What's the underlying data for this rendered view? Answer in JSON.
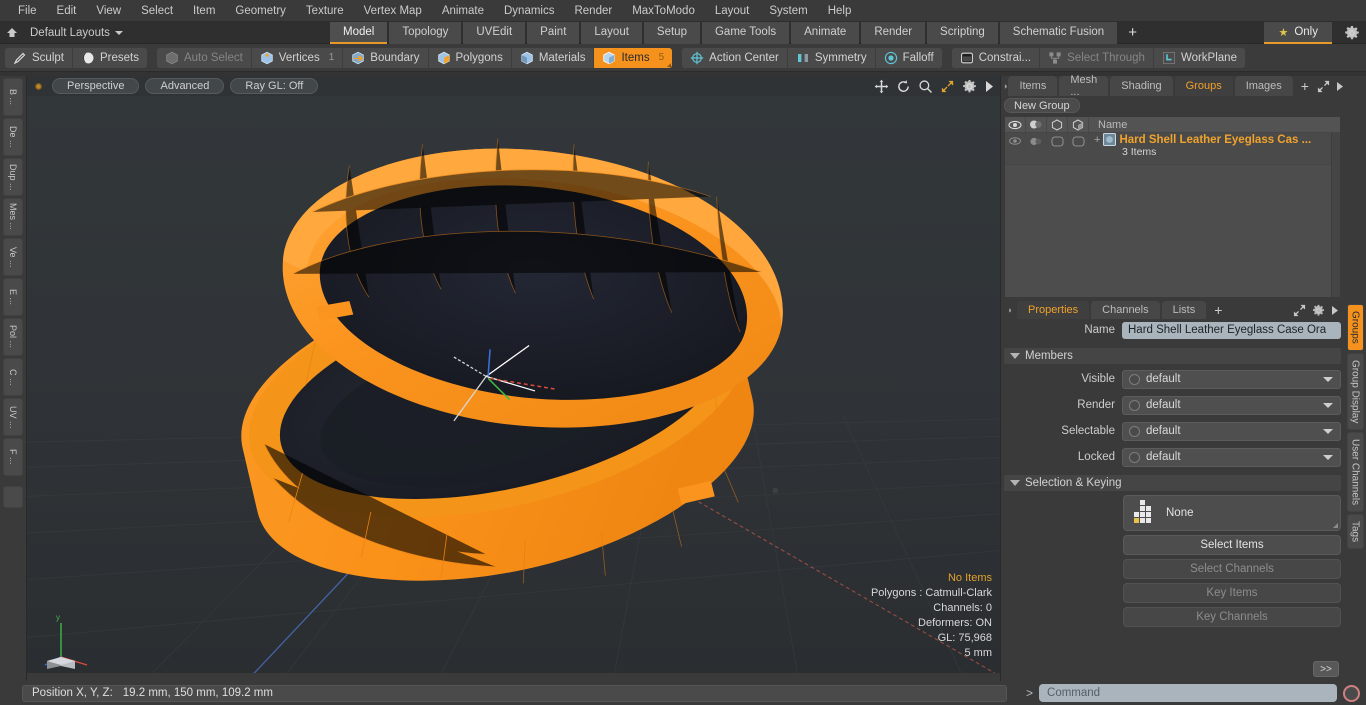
{
  "app": {
    "title": "MODO 3D Modeling"
  },
  "menubar": {
    "items": [
      "File",
      "Edit",
      "View",
      "Select",
      "Item",
      "Geometry",
      "Texture",
      "Vertex Map",
      "Animate",
      "Dynamics",
      "Render",
      "MaxToModo",
      "Layout",
      "System",
      "Help"
    ]
  },
  "layoutbar": {
    "home_icon": "home-icon",
    "layout_name": "Default Layouts",
    "tabs": [
      {
        "label": "Model",
        "active": true
      },
      {
        "label": "Topology",
        "active": false
      },
      {
        "label": "UVEdit",
        "active": false
      },
      {
        "label": "Paint",
        "active": false
      },
      {
        "label": "Layout",
        "active": false
      },
      {
        "label": "Setup",
        "active": false
      },
      {
        "label": "Game Tools",
        "active": false
      },
      {
        "label": "Animate",
        "active": false
      },
      {
        "label": "Render",
        "active": false
      },
      {
        "label": "Scripting",
        "active": false
      },
      {
        "label": "Schematic Fusion",
        "active": false
      }
    ],
    "add_tab_label": "+",
    "only_label": "Only",
    "only_icon": "star-icon",
    "gear_icon": "gear-icon"
  },
  "modebar": {
    "group1": [
      {
        "label": "Sculpt",
        "icon": "pen-icon",
        "state": "normal"
      },
      {
        "label": "Presets",
        "icon": "sphere-icon",
        "state": "normal"
      }
    ],
    "group2": [
      {
        "label": "Auto Select",
        "icon": "cube-gray-icon",
        "state": "dim",
        "count": ""
      },
      {
        "label": "Vertices",
        "icon": "cube-vertex-icon",
        "state": "normal",
        "count": "1"
      },
      {
        "label": "Boundary",
        "icon": "cube-boundary-icon",
        "state": "normal",
        "count": ""
      },
      {
        "label": "Polygons",
        "icon": "cube-poly-icon",
        "state": "normal",
        "count": ""
      },
      {
        "label": "Materials",
        "icon": "cube-material-icon",
        "state": "normal",
        "count": ""
      },
      {
        "label": "Items",
        "icon": "cube-items-icon",
        "state": "selected",
        "count": "5"
      }
    ],
    "group3": [
      {
        "label": "Action Center",
        "icon": "target-icon",
        "state": "normal"
      },
      {
        "label": "Symmetry",
        "icon": "symmetry-icon",
        "state": "normal"
      },
      {
        "label": "Falloff",
        "icon": "falloff-icon",
        "state": "normal"
      }
    ],
    "group4": [
      {
        "label": "Constrai...",
        "icon": "constraint-icon",
        "state": "normal"
      },
      {
        "label": "Select Through",
        "icon": "select-through-icon",
        "state": "dim"
      },
      {
        "label": "WorkPlane",
        "icon": "workplane-icon",
        "state": "normal"
      }
    ]
  },
  "leftrail": {
    "tabs": [
      "B ...",
      "De ...",
      "Dup ...",
      "Mes ...",
      "Ve ...",
      "E ...",
      "Pol ...",
      "C ...",
      "UV ...",
      "F ..."
    ]
  },
  "viewport": {
    "indicator_icon": "view-dot-icon",
    "pills": [
      "Perspective",
      "Advanced",
      "Ray GL: Off"
    ],
    "icons": [
      "move-icon",
      "rotate-icon",
      "zoom-icon",
      "fit-icon",
      "gear-icon",
      "play-icon"
    ],
    "info": {
      "status": "No Items",
      "polygons": "Polygons : Catmull-Clark",
      "channels": "Channels: 0",
      "deformers": "Deformers: ON",
      "gl": "GL: 75,968",
      "scale": "5 mm"
    },
    "model": {
      "name": "Hard Shell Leather Eyeglass Case",
      "shell_color": "#f8931f",
      "shell_shadow": "#e07b10",
      "interior_color": "#1d2028",
      "background_color": "#2f3336"
    }
  },
  "rightpanel": {
    "tabs": [
      {
        "label": "Items",
        "active": false
      },
      {
        "label": "Mesh ...",
        "active": false
      },
      {
        "label": "Shading",
        "active": false
      },
      {
        "label": "Groups",
        "active": true
      },
      {
        "label": "Images",
        "active": false
      }
    ],
    "add_tab_label": "+",
    "expand_icon": "expand-icon",
    "arrow_icon": "chevron-right-icon",
    "new_group_label": "New Group",
    "grouplist": {
      "columns": [
        "eye-icon",
        "render-icon",
        "wire-icon",
        "shade-icon"
      ],
      "name_header": "Name",
      "rows": [
        {
          "expander": "+",
          "icon": "group-icon",
          "title": "Hard Shell Leather Eyeglass Cas ...",
          "subtitle": "3 Items"
        }
      ]
    },
    "properties": {
      "tabs": [
        {
          "label": "Properties",
          "active": true
        },
        {
          "label": "Channels",
          "active": false
        },
        {
          "label": "Lists",
          "active": false
        }
      ],
      "add_tab_label": "+",
      "name_label": "Name",
      "name_value": "Hard Shell Leather Eyeglass Case Ora",
      "members_section": "Members",
      "fields": [
        {
          "label": "Visible",
          "value": "default"
        },
        {
          "label": "Render",
          "value": "default"
        },
        {
          "label": "Selectable",
          "value": "default"
        },
        {
          "label": "Locked",
          "value": "default"
        }
      ],
      "selection_section": "Selection & Keying",
      "none_label": "None",
      "none_icon": "pixel-grid-icon",
      "buttons": [
        {
          "label": "Select Items",
          "enabled": true
        },
        {
          "label": "Select Channels",
          "enabled": false
        },
        {
          "label": "Key Items",
          "enabled": false
        },
        {
          "label": "Key Channels",
          "enabled": false
        }
      ],
      "more_label": ">>"
    },
    "vertical_tabs": [
      {
        "label": "Groups",
        "active": true
      },
      {
        "label": "Group Display",
        "active": false
      },
      {
        "label": "User Channels",
        "active": false
      },
      {
        "label": "Tags",
        "active": false
      }
    ]
  },
  "statusbar": {
    "position_label": "Position X, Y, Z:",
    "position_value": "19.2 mm,  150 mm,  109.2 mm",
    "command_prompt": ">",
    "command_placeholder": "Command",
    "record_icon": "record-icon"
  }
}
